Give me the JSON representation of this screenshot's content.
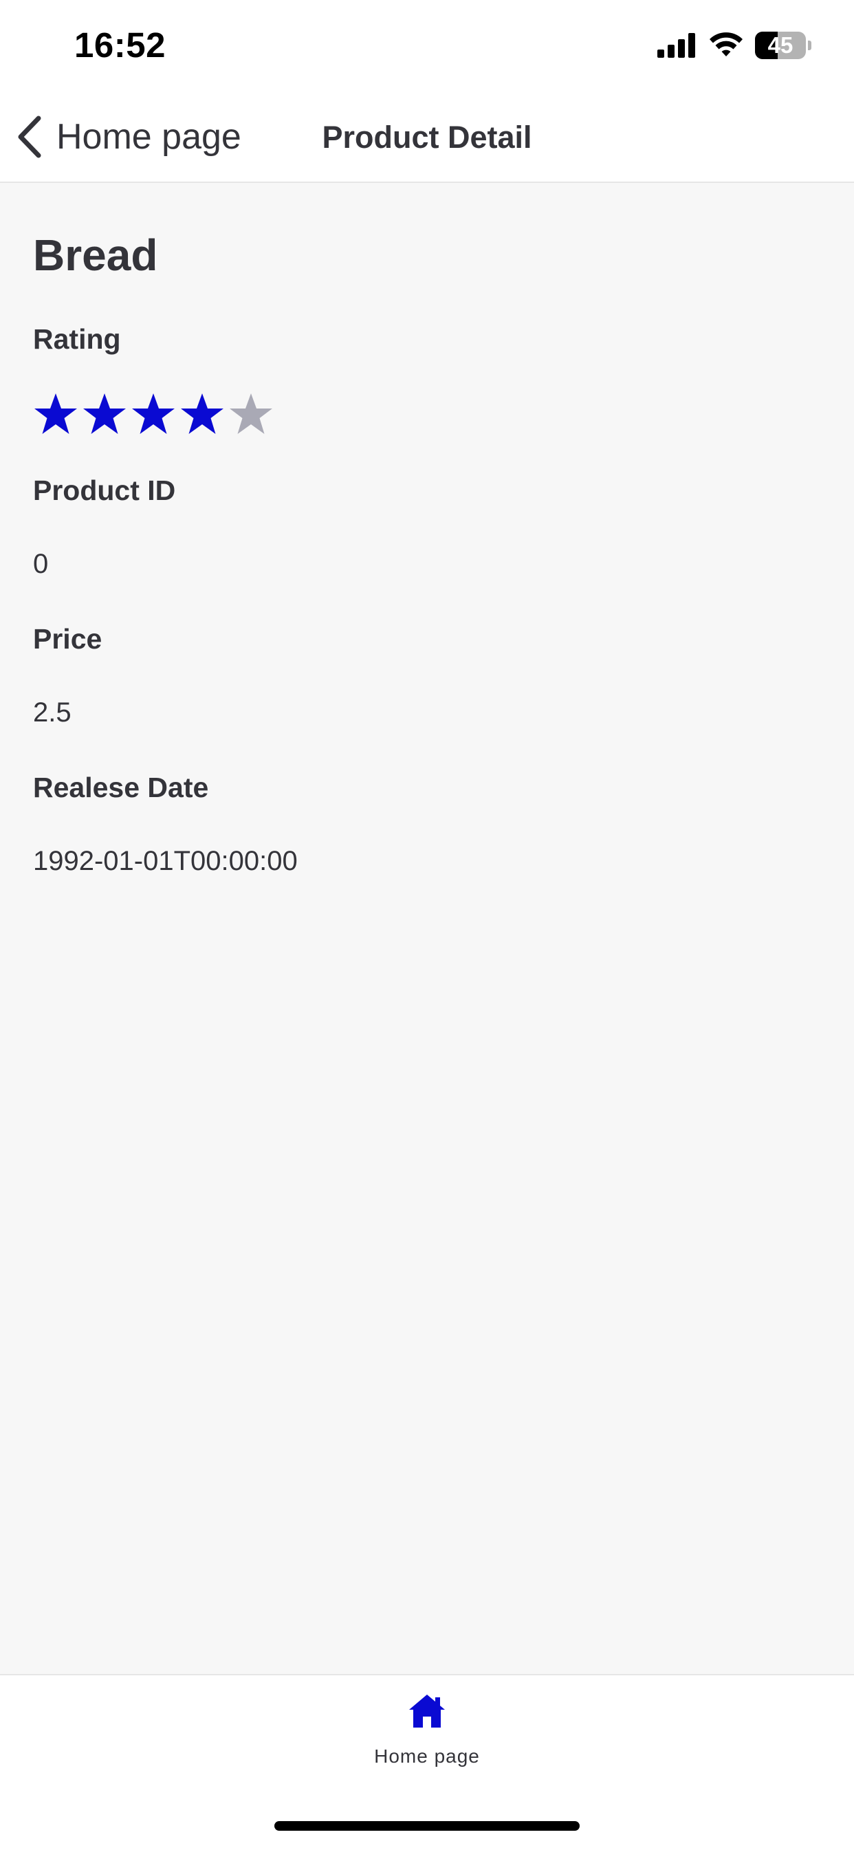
{
  "status_bar": {
    "time": "16:52",
    "battery": {
      "label": "45",
      "level": 0.45
    },
    "icons": [
      "cellular-signal-icon",
      "wifi-icon",
      "battery-icon"
    ]
  },
  "header": {
    "back_label": "Home page",
    "title": "Product Detail",
    "back_icon": "chevron-left-icon"
  },
  "product": {
    "name": "Bread",
    "rating_label": "Rating",
    "rating": {
      "value": 4,
      "max": 5
    },
    "id_label": "Product ID",
    "id_value": "0",
    "price_label": "Price",
    "price_value": "2.5",
    "date_label": "Realese Date",
    "date_value": "1992-01-01T00:00:00"
  },
  "tab_bar": {
    "items": [
      {
        "label": "Home page",
        "icon": "home-icon",
        "active": true
      }
    ]
  },
  "colors": {
    "accent": "#0a0ad2",
    "star_inactive": "#a9a9b5",
    "text": "#34343a",
    "background": "#f7f7f7",
    "surface": "#ffffff"
  }
}
